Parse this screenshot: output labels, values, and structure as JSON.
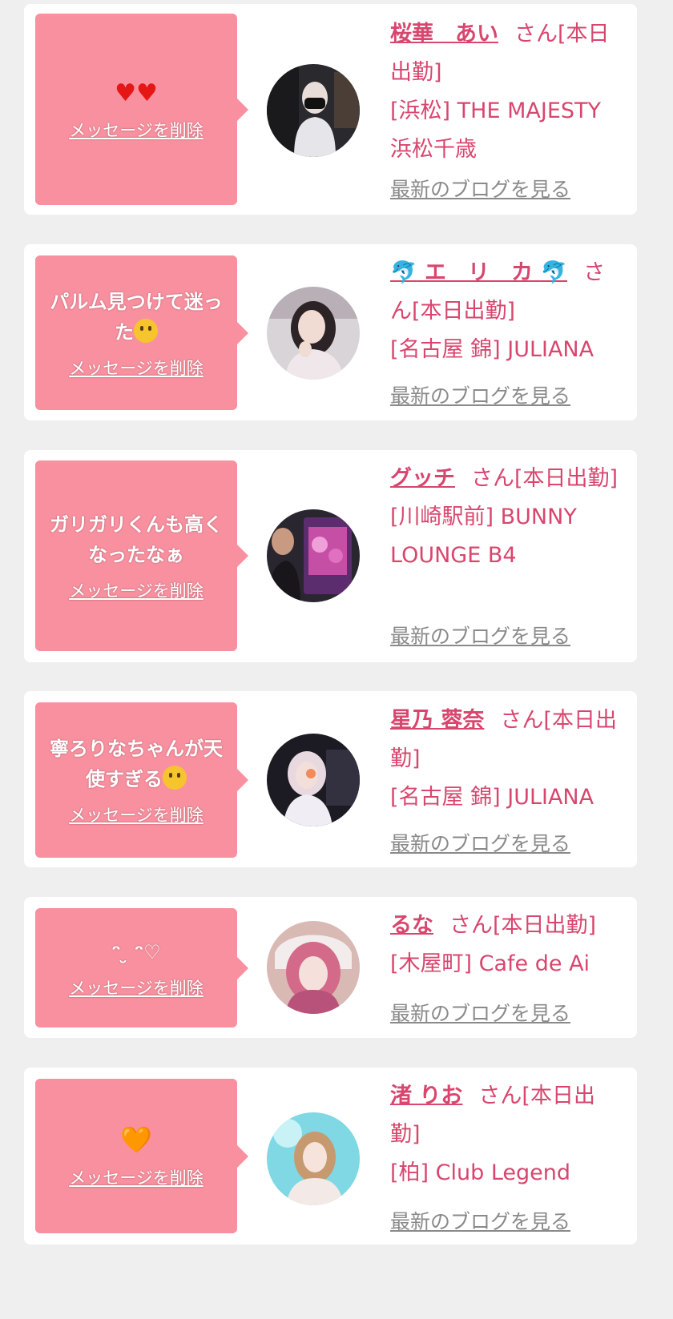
{
  "delete_label": "メッセージを削除",
  "blog_label": "最新のブログを見る",
  "cards": [
    {
      "message": "",
      "message_icon": "♥♥",
      "name": "桜華　あい",
      "suffix": "さん[本日出勤]",
      "shop": "[浜松] THE MAJESTY 浜松千歳"
    },
    {
      "message": "パルム見つけて迷った",
      "message_icon": "drooling-face-emoji",
      "name_prefix_icon": "🐬",
      "name": "エ　リ　カ",
      "name_suffix_icon": "🐬",
      "suffix": "さん[本日出勤]",
      "shop": "[名古屋 錦] JULIANA"
    },
    {
      "message": "ガリガリくんも高くなったなぁ",
      "name": "グッチ",
      "suffix": "さん[本日出勤]",
      "shop": "[川崎駅前] BUNNY LOUNGE B4"
    },
    {
      "message": "寧ろりなちゃんが天使すぎる",
      "message_icon": "pleading-face-emoji",
      "name": "星乃 蓉奈",
      "suffix": "さん[本日出勤]",
      "shop": "[名古屋 錦] JULIANA"
    },
    {
      "message": "ᵔ ̮ ᵔ♡",
      "name": "るな",
      "suffix": "さん[本日出勤]",
      "shop": "[木屋町] Cafe de Ai"
    },
    {
      "message": "",
      "message_icon": "🧡",
      "name": "渚 りお",
      "suffix": "さん[本日出勤]",
      "shop": "[柏] Club Legend"
    }
  ],
  "colors": {
    "bubble": "#f9909f",
    "accent": "#d8466e",
    "link_gray": "#8a8a8a",
    "background": "#efefef"
  }
}
